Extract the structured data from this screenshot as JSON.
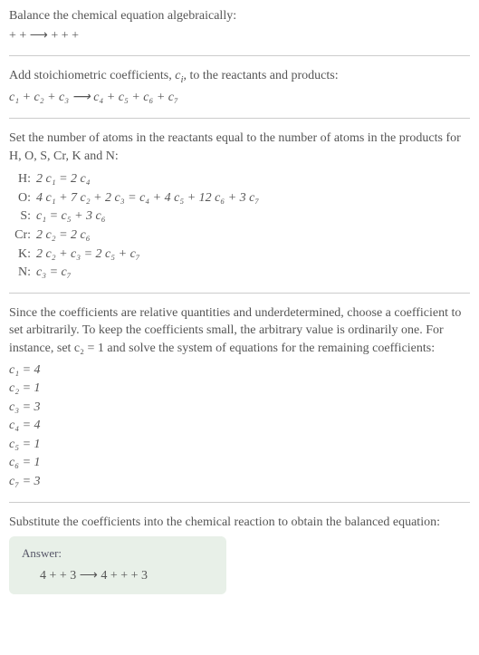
{
  "section1": {
    "line1": "Balance the chemical equation algebraically:",
    "line2": " +  +   ⟶   +  +  + "
  },
  "section2": {
    "line1_pre": "Add stoichiometric coefficients, ",
    "line1_ci": "c",
    "line1_i": "i",
    "line1_post": ", to the reactants and products:",
    "line2": "c₁  + c₂  + c₃   ⟶  c₄  + c₅  + c₆  + c₇ "
  },
  "section3": {
    "intro": "Set the number of atoms in the reactants equal to the number of atoms in the products for H, O, S, Cr, K and N:",
    "rows": [
      {
        "label": "H:",
        "eq": "2 c₁ = 2 c₄"
      },
      {
        "label": "O:",
        "eq": "4 c₁ + 7 c₂ + 2 c₃ = c₄ + 4 c₅ + 12 c₆ + 3 c₇"
      },
      {
        "label": "S:",
        "eq": "c₁ = c₅ + 3 c₆"
      },
      {
        "label": "Cr:",
        "eq": "2 c₂ = 2 c₆"
      },
      {
        "label": "K:",
        "eq": "2 c₂ + c₃ = 2 c₅ + c₇"
      },
      {
        "label": "N:",
        "eq": "c₃ = c₇"
      }
    ]
  },
  "section4": {
    "intro": "Since the coefficients are relative quantities and underdetermined, choose a coefficient to set arbitrarily. To keep the coefficients small, the arbitrary value is ordinarily one. For instance, set c₂ = 1 and solve the system of equations for the remaining coefficients:",
    "coeffs": [
      "c₁ = 4",
      "c₂ = 1",
      "c₃ = 3",
      "c₄ = 4",
      "c₅ = 1",
      "c₆ = 1",
      "c₇ = 3"
    ]
  },
  "section5": {
    "intro": "Substitute the coefficients into the chemical reaction to obtain the balanced equation:",
    "answer_label": "Answer:",
    "answer_eq": "4  +  + 3   ⟶  4  +  +  + 3 "
  }
}
